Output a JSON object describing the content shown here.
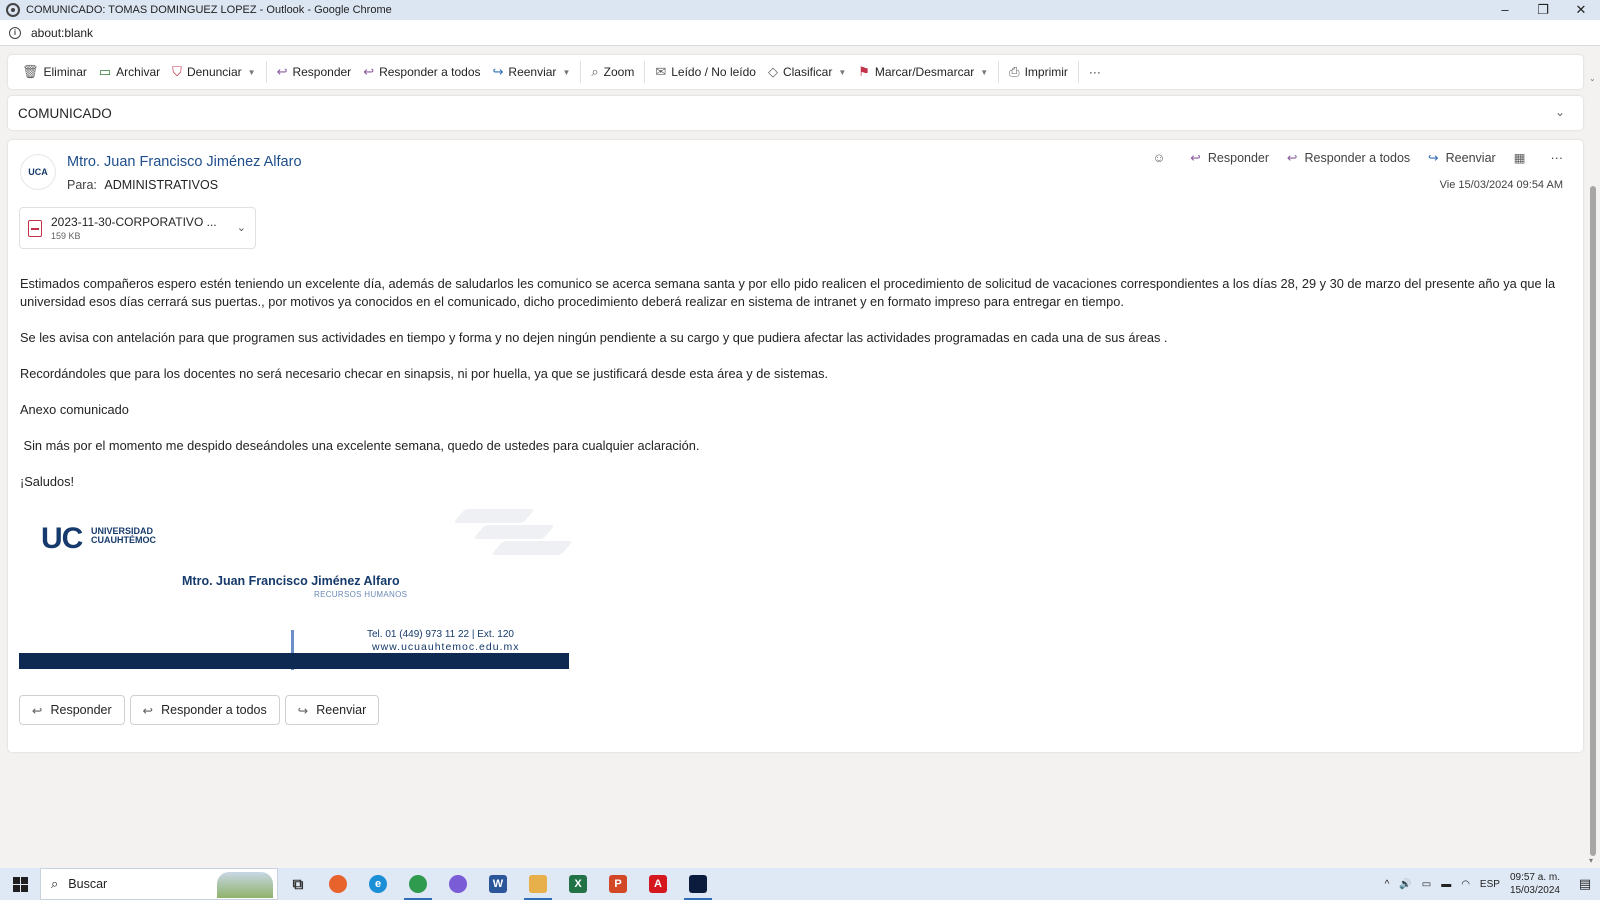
{
  "window": {
    "title": "COMUNICADO: TOMAS DOMINGUEZ LOPEZ - Outlook - Google Chrome",
    "minimize": "–",
    "restore": "❐",
    "close": "✕"
  },
  "address": {
    "url": "about:blank",
    "info_icon": "i"
  },
  "toolbar": {
    "items": [
      {
        "label": "Eliminar",
        "icon": "trash-icon"
      },
      {
        "label": "Archivar",
        "icon": "archive-icon"
      },
      {
        "label": "Denunciar",
        "icon": "shield-icon"
      },
      {
        "label": "Responder",
        "icon": "reply-icon"
      },
      {
        "label": "Responder a todos",
        "icon": "reply-all-icon"
      },
      {
        "label": "Reenviar",
        "icon": "forward-icon"
      },
      {
        "label": "Zoom",
        "icon": "zoom-icon"
      },
      {
        "label": "Leído / No leído",
        "icon": "envelope-open-icon"
      },
      {
        "label": "Clasificar",
        "icon": "tag-icon"
      },
      {
        "label": "Marcar/Desmarcar",
        "icon": "flag-icon"
      },
      {
        "label": "Imprimir",
        "icon": "printer-icon"
      }
    ],
    "more": "···"
  },
  "subject": {
    "text": "COMUNICADO"
  },
  "message": {
    "avatar_text": "UCA",
    "sender": "Mtro. Juan Francisco Jiménez Alfaro",
    "to_label": "Para:",
    "to_value": "ADMINISTRATIVOS",
    "date": "Vie 15/03/2024 09:54 AM",
    "actions": {
      "reply": "Responder",
      "reply_all": "Responder a todos",
      "forward": "Reenviar",
      "more": "···"
    },
    "attachment": {
      "name": "2023-11-30-CORPORATIVO ...",
      "size": "159 KB"
    },
    "body": [
      "Estimados compañeros espero estén teniendo un excelente día, además de saludarlos les comunico se acerca semana santa y por ello pido realicen el procedimiento de solicitud de vacaciones correspondientes a los días 28, 29 y 30 de marzo del presente año ya que la universidad esos días cerrará sus puertas., por motivos ya conocidos en el comunicado, dicho procedimiento deberá realizar en sistema de intranet y en formato impreso para entregar en tiempo.",
      "Se les avisa con antelación para que programen sus actividades en tiempo y forma y no dejen ningún pendiente a su cargo y que pudiera afectar las actividades programadas en cada una de sus áreas .",
      "Recordándoles que para los docentes no será necesario checar en sinapsis, ni por huella, ya que se justificará desde esta área y de sistemas.",
      "Anexo comunicado",
      " Sin más por el momento me despido deseándoles una excelente semana, quedo de ustedes para cualquier aclaración.",
      "¡Saludos!"
    ],
    "signature": {
      "logo_letters": "UC",
      "logo_name_1": "UNIVERSIDAD",
      "logo_name_2": "CUAUHTÉMOC",
      "name": "Mtro. Juan Francisco Jiménez Alfaro",
      "role": "RECURSOS HUMANOS",
      "tel": "Tel. 01 (449) 973 11 22 | Ext. 120",
      "web": "www.ucuauhtemoc.edu.mx"
    },
    "bottom_actions": {
      "reply": "Responder",
      "reply_all": "Responder a todos",
      "forward": "Reenviar"
    }
  },
  "taskbar": {
    "search_placeholder": "Buscar",
    "apps": [
      {
        "name": "task-view",
        "glyph": "⧉",
        "color": "#333333"
      },
      {
        "name": "firefox",
        "glyph": "",
        "color": "#e8622c"
      },
      {
        "name": "edge",
        "glyph": "e",
        "color": "#1a8fd6"
      },
      {
        "name": "chrome",
        "glyph": "",
        "color": "#2e9b4f"
      },
      {
        "name": "copilot",
        "glyph": "",
        "color": "#7a5cd6"
      },
      {
        "name": "word",
        "glyph": "W",
        "color": "#2b579a"
      },
      {
        "name": "explorer",
        "glyph": "",
        "color": "#e8b04a"
      },
      {
        "name": "excel",
        "glyph": "X",
        "color": "#217346"
      },
      {
        "name": "powerpoint",
        "glyph": "P",
        "color": "#d24726"
      },
      {
        "name": "acrobat",
        "glyph": "A",
        "color": "#d4181e"
      },
      {
        "name": "webex",
        "glyph": "",
        "color": "#0c1c3d"
      }
    ],
    "lang": "ESP",
    "time": "09:57 a. m.",
    "date": "15/03/2024"
  }
}
